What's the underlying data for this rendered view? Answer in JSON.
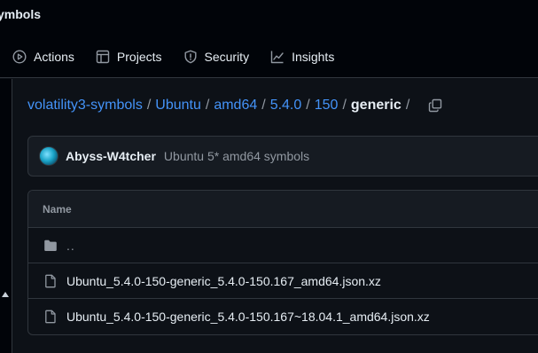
{
  "repo": {
    "name_fragment": "ymbols"
  },
  "nav": {
    "tabs": [
      {
        "label": "Actions",
        "icon": "play-circle-icon"
      },
      {
        "label": "Projects",
        "icon": "table-icon"
      },
      {
        "label": "Security",
        "icon": "shield-icon"
      },
      {
        "label": "Insights",
        "icon": "graph-icon"
      }
    ]
  },
  "breadcrumb": {
    "items": [
      "volatility3-symbols",
      "Ubuntu",
      "amd64",
      "5.4.0",
      "150"
    ],
    "current": "generic",
    "separator": "/"
  },
  "commit": {
    "author": "Abyss-W4tcher",
    "message": "Ubuntu 5* amd64 symbols"
  },
  "files": {
    "header": "Name",
    "parent": "..",
    "rows": [
      {
        "name": "Ubuntu_5.4.0-150-generic_5.4.0-150.167_amd64.json.xz",
        "icon": "file-icon"
      },
      {
        "name": "Ubuntu_5.4.0-150-generic_5.4.0-150.167~18.04.1_amd64.json.xz",
        "icon": "file-icon"
      }
    ]
  },
  "colors": {
    "background": "#0d1117",
    "header_bg": "#010409",
    "link": "#4493f8",
    "border": "#30363d",
    "muted": "#9198a1"
  }
}
